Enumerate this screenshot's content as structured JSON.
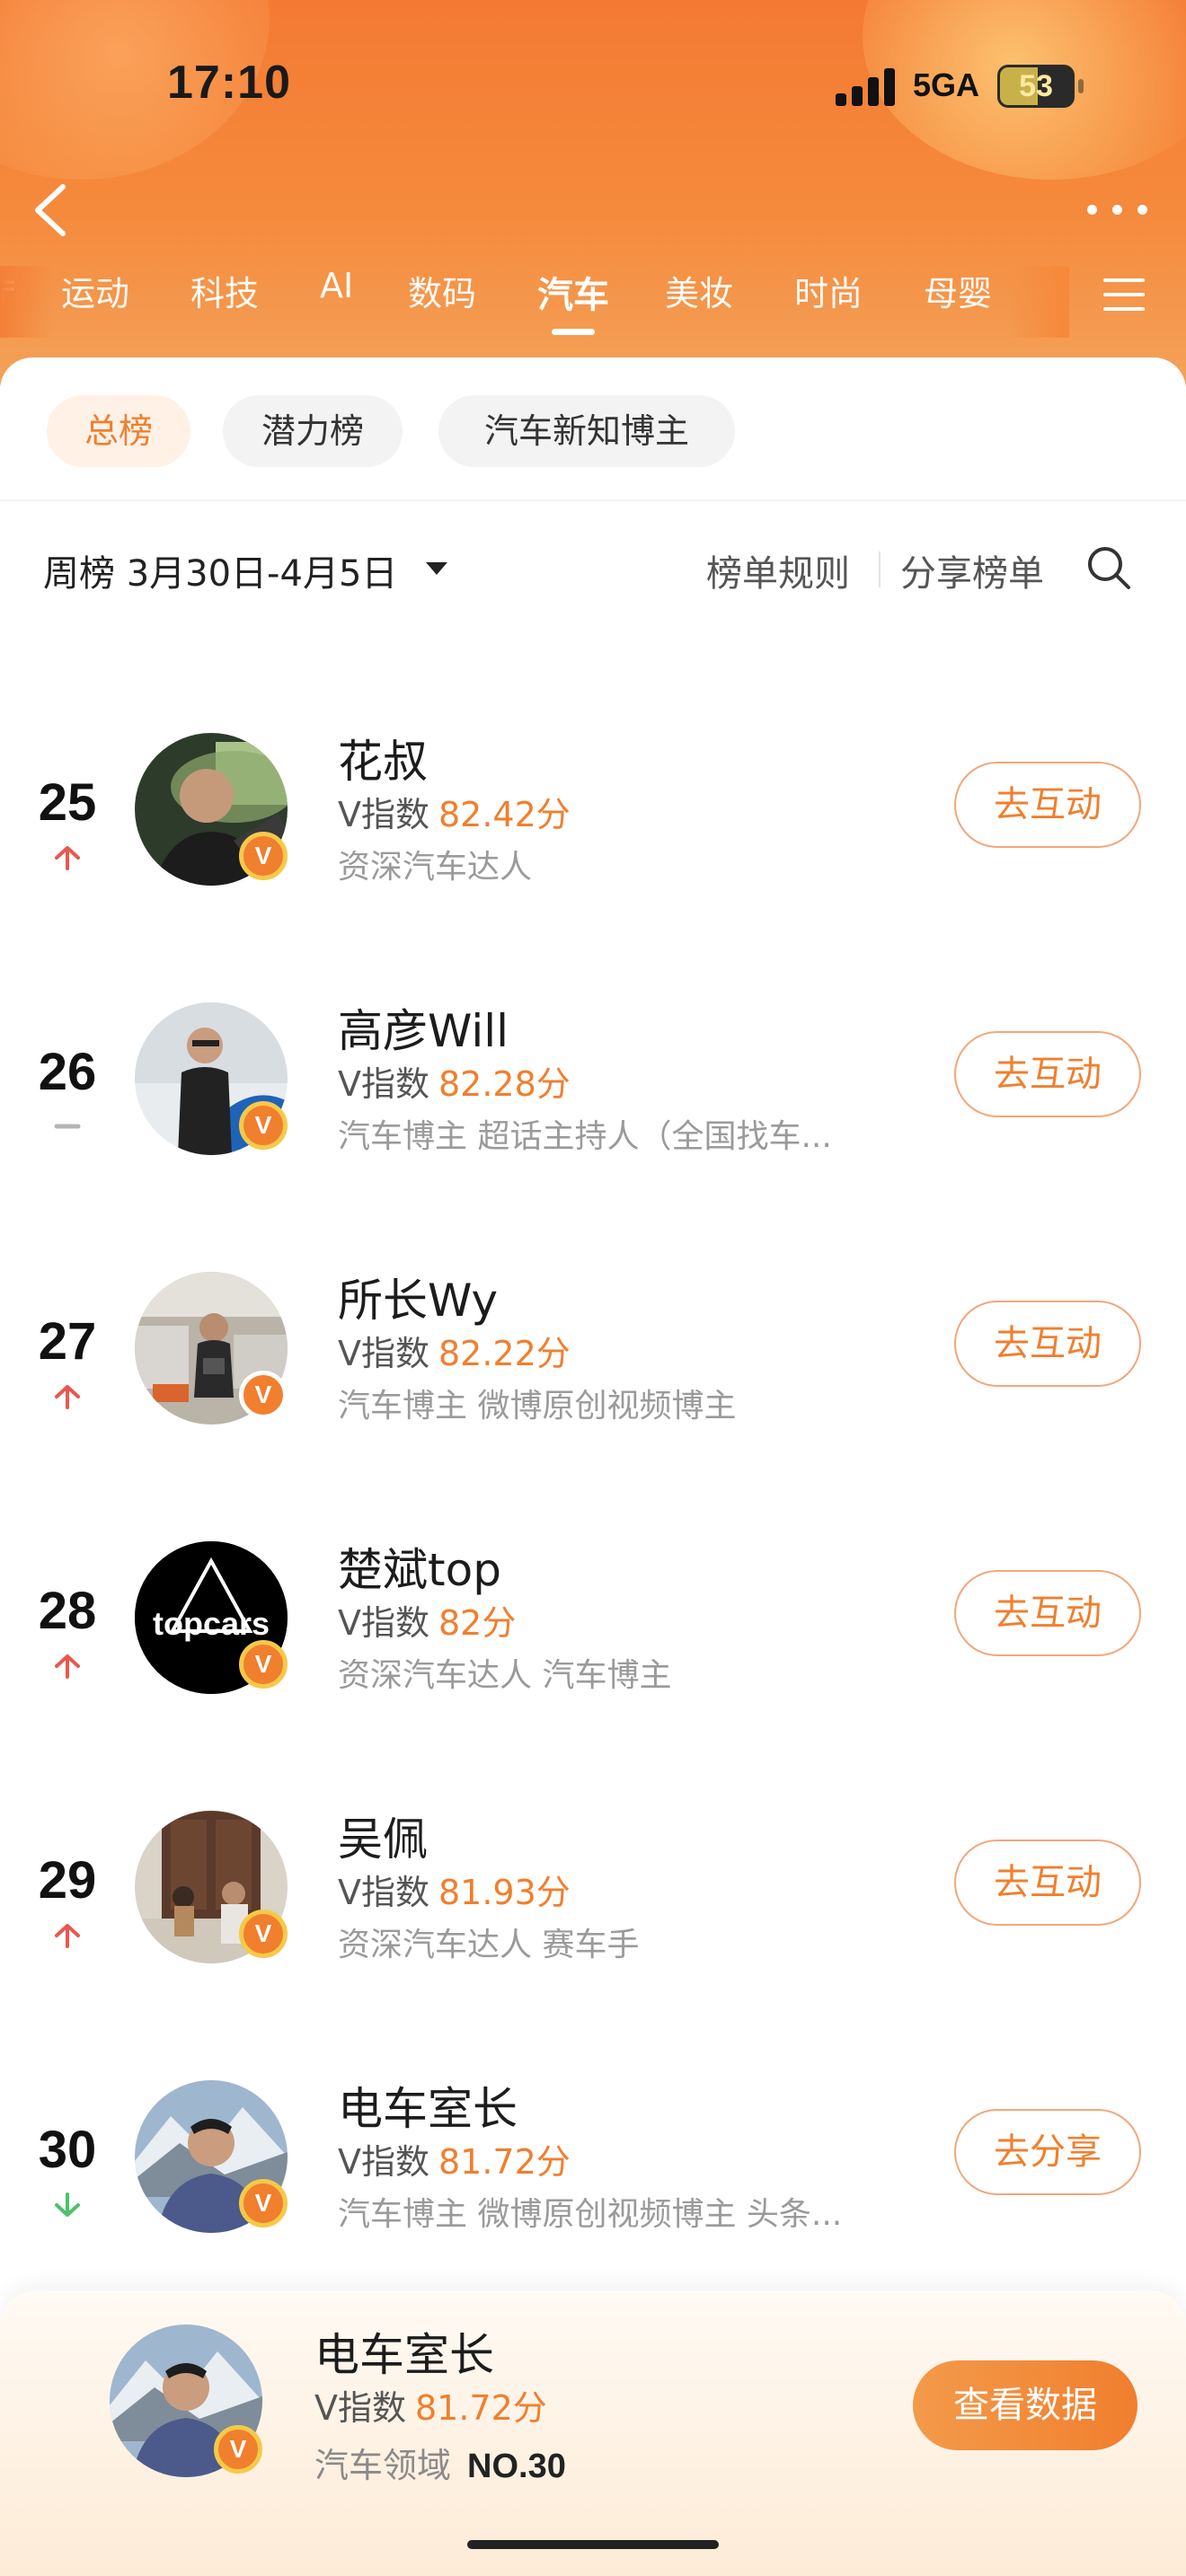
{
  "status_bar": {
    "time": "17:10",
    "network": "5GA",
    "battery": "53",
    "battery_level_pct": 53
  },
  "nav": {
    "back_icon": "chevron-left-icon",
    "more_icon": "more-dots-icon",
    "menu_icon": "hamburger-menu-icon"
  },
  "tabs": [
    {
      "label": "运动"
    },
    {
      "label": "科技"
    },
    {
      "label": "AI"
    },
    {
      "label": "数码"
    },
    {
      "label": "汽车",
      "active": true
    },
    {
      "label": "美妆"
    },
    {
      "label": "时尚"
    },
    {
      "label": "母婴"
    }
  ],
  "filters": [
    {
      "label": "总榜",
      "active": true
    },
    {
      "label": "潜力榜"
    },
    {
      "label": "汽车新知博主"
    }
  ],
  "period_label": "周榜 3月30日-4月5日",
  "links": {
    "rules": "榜单规则",
    "share": "分享榜单"
  },
  "rows": [
    {
      "rank": "25",
      "trend": "up",
      "name": "花叔",
      "vindex_label": "V指数",
      "score": "82.42分",
      "desc": "资深汽车达人",
      "action": "去互动"
    },
    {
      "rank": "26",
      "trend": "same",
      "name": "高彦Will",
      "vindex_label": "V指数",
      "score": "82.28分",
      "desc": "汽车博主 超话主持人（全国找车...",
      "action": "去互动"
    },
    {
      "rank": "27",
      "trend": "up",
      "name": "所长Wy",
      "vindex_label": "V指数",
      "score": "82.22分",
      "desc": "汽车博主 微博原创视频博主",
      "action": "去互动"
    },
    {
      "rank": "28",
      "trend": "up",
      "name": "楚斌top",
      "vindex_label": "V指数",
      "score": "82分",
      "desc": "资深汽车达人 汽车博主",
      "action": "去互动",
      "avatar_text": "topcars"
    },
    {
      "rank": "29",
      "trend": "up",
      "name": "吴佩",
      "vindex_label": "V指数",
      "score": "81.93分",
      "desc": "资深汽车达人 赛车手",
      "action": "去互动"
    },
    {
      "rank": "30",
      "trend": "down",
      "name": "电车室长",
      "vindex_label": "V指数",
      "score": "81.72分",
      "desc": "汽车博主 微博原创视频博主 头条...",
      "action": "去分享"
    }
  ],
  "badge_letter": "V",
  "me": {
    "name": "电车室长",
    "vindex_label": "V指数",
    "score": "81.72分",
    "domain": "汽车领域",
    "rank": "NO.30",
    "button": "查看数据"
  },
  "colors": {
    "accent": "#f07f2e",
    "header": "#f47a33",
    "trend_up": "#e8584f",
    "trend_down": "#4cc26a",
    "trend_same": "#b5b5b5"
  }
}
